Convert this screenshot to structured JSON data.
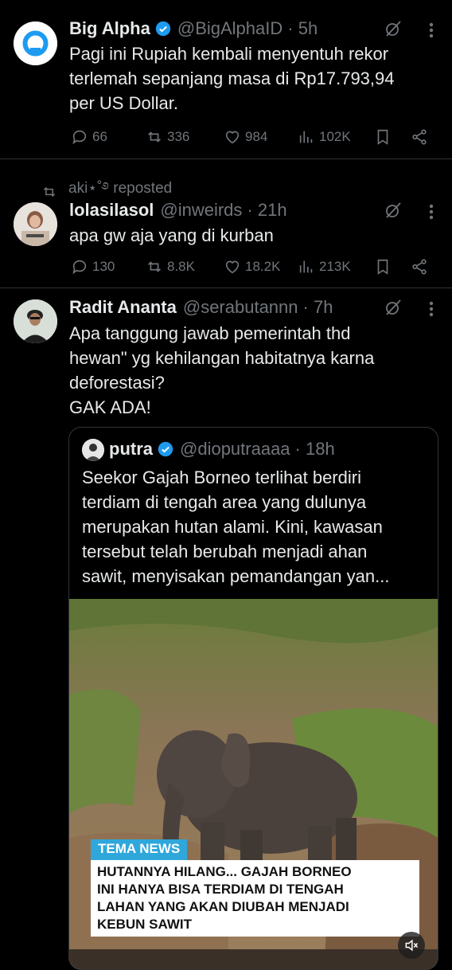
{
  "tweets": [
    {
      "name": "Big Alpha",
      "handle": "@BigAlphaID",
      "time": "· 5h",
      "lines": [
        "Pagi ini Rupiah kembali menyentuh rekor",
        "terlemah sepanjang masa di Rp17.793,94",
        "per US Dollar."
      ],
      "replies": "66",
      "reposts": "336",
      "likes": "984",
      "views": "102K"
    },
    {
      "repost_label": "aki⋆˚࿔ reposted",
      "name": "lolasilasol",
      "handle": "@inweirds",
      "time": "· 21h",
      "lines": [
        "apa gw aja yang di kurban"
      ],
      "replies": "130",
      "reposts": "8.8K",
      "likes": "18.2K",
      "views": "213K"
    },
    {
      "name": "Radit Ananta",
      "handle": "@serabutannn",
      "time": "· 7h",
      "lines": [
        "Apa tanggung jawab pemerintah thd",
        "hewan\" yg kehilangan habitatnya karna",
        "deforestasi?",
        "GAK ADA!"
      ]
    }
  ],
  "quote": {
    "name": "putra",
    "handle": "@dioputraaaa",
    "time": "· 18h",
    "lines": [
      "Seekor Gajah Borneo terlihat berdiri",
      "terdiam di tengah area yang dulunya",
      "merupakan hutan alami. Kini, kawasan",
      "tersebut telah berubah menjadi ahan",
      "sawit, menyisakan pemandangan yan..."
    ],
    "media_tag": "TEMA NEWS",
    "media_headline": [
      "HUTANNYA HILANG... GAJAH BORNEO",
      "INI HANYA BISA TERDIAM DI TENGAH",
      "LAHAN YANG AKAN DIUBAH MENJADI",
      "KEBUN SAWIT"
    ]
  },
  "colors": {
    "background": "#000000",
    "text": "#e7e9ea",
    "muted": "#71767b",
    "verified": "#1d9bf0",
    "divider": "#2f3336"
  }
}
